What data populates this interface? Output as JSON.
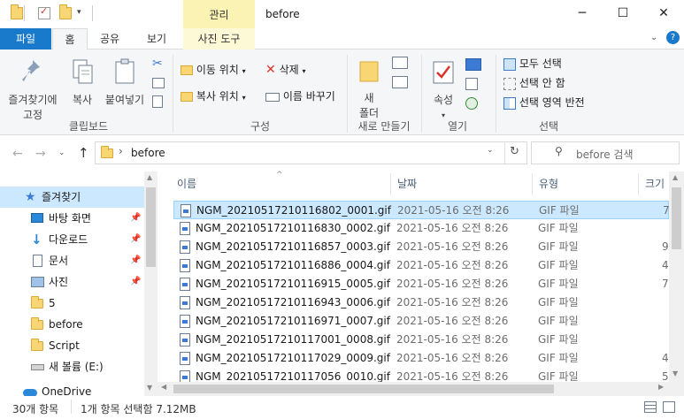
{
  "window": {
    "context_tab_label": "관리",
    "title": "before",
    "minimize_glyph": "─",
    "maximize_glyph": "☐",
    "close_glyph": "✕"
  },
  "ribbon_tabs": {
    "file": "파일",
    "home": "홈",
    "share": "공유",
    "view": "보기",
    "picture_tools": "사진 도구"
  },
  "ribbon": {
    "pin_quick_access": "즐겨찾기에\n고정",
    "copy": "복사",
    "paste": "붙여넣기",
    "clipboard_group": "클립보드",
    "move_to": "이동 위치",
    "copy_to": "복사 위치",
    "delete": "삭제",
    "rename": "이름 바꾸기",
    "organize_group": "구성",
    "new_folder": "새\n폴더",
    "new_group": "새로 만들기",
    "properties": "속성",
    "open_group": "열기",
    "select_all": "모두 선택",
    "select_none": "선택 안 함",
    "invert_selection": "선택 영역 반전",
    "select_group": "선택"
  },
  "address": {
    "path_item": "before",
    "search_placeholder": "before 검색"
  },
  "nav": {
    "quick_access": "즐겨찾기",
    "items": [
      {
        "label": "바탕 화면"
      },
      {
        "label": "다운로드"
      },
      {
        "label": "문서"
      },
      {
        "label": "사진"
      },
      {
        "label": "5"
      },
      {
        "label": "before"
      },
      {
        "label": "Script"
      },
      {
        "label": "새 볼륨 (E:)"
      }
    ],
    "onedrive": "OneDrive"
  },
  "columns": {
    "name": "이름",
    "date": "날짜",
    "type": "유형",
    "size": "크기"
  },
  "files": [
    {
      "name": "NGM_20210517210116802_0001.gif",
      "date": "2021-05-16 오전 8:26",
      "type": "GIF 파일",
      "size": "7"
    },
    {
      "name": "NGM_20210517210116830_0002.gif",
      "date": "2021-05-16 오전 8:26",
      "type": "GIF 파일",
      "size": ""
    },
    {
      "name": "NGM_20210517210116857_0003.gif",
      "date": "2021-05-16 오전 8:26",
      "type": "GIF 파일",
      "size": "9"
    },
    {
      "name": "NGM_20210517210116886_0004.gif",
      "date": "2021-05-16 오전 8:26",
      "type": "GIF 파일",
      "size": "4"
    },
    {
      "name": "NGM_20210517210116915_0005.gif",
      "date": "2021-05-16 오전 8:26",
      "type": "GIF 파일",
      "size": "7"
    },
    {
      "name": "NGM_20210517210116943_0006.gif",
      "date": "2021-05-16 오전 8:26",
      "type": "GIF 파일",
      "size": ""
    },
    {
      "name": "NGM_20210517210116971_0007.gif",
      "date": "2021-05-16 오전 8:26",
      "type": "GIF 파일",
      "size": ""
    },
    {
      "name": "NGM_20210517210117001_0008.gif",
      "date": "2021-05-16 오전 8:26",
      "type": "GIF 파일",
      "size": ""
    },
    {
      "name": "NGM_20210517210117029_0009.gif",
      "date": "2021-05-16 오전 8:26",
      "type": "GIF 파일",
      "size": "4"
    },
    {
      "name": "NGM_20210517210117056_0010.gif",
      "date": "2021-05-16 오전 8:26",
      "type": "GIF 파일",
      "size": "5"
    }
  ],
  "status": {
    "item_count": "30개 항목",
    "selection": "1개 항목 선택함 7.12MB"
  },
  "colors": {
    "file_tab": "#1979ca",
    "selection": "#cce8ff",
    "context_tab": "#fbf3b4"
  }
}
